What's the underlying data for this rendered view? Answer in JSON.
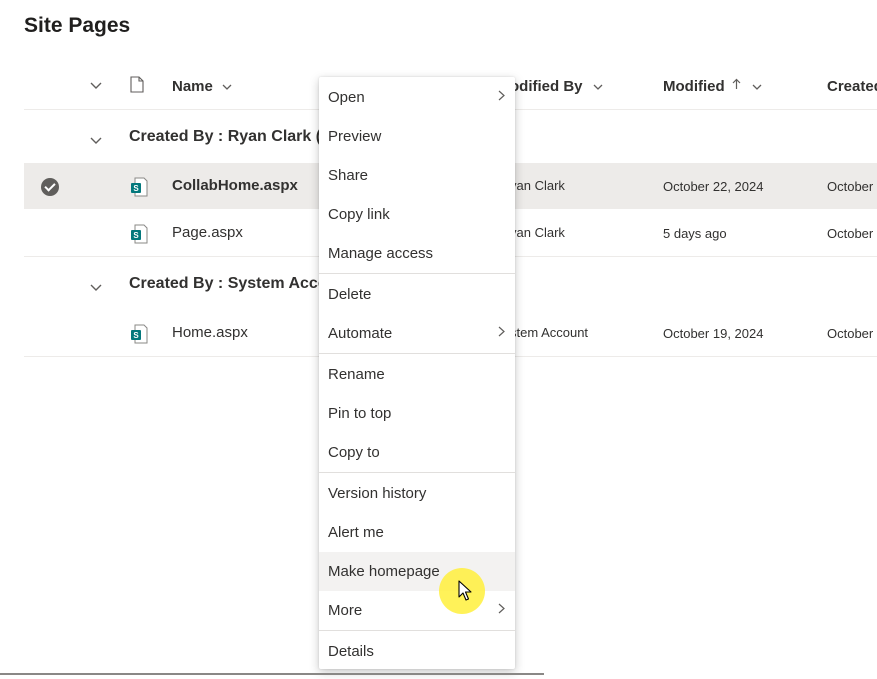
{
  "page": {
    "title": "Site Pages"
  },
  "columns": {
    "name": "Name",
    "modified_by": "odified By",
    "modified": "Modified",
    "modified_sort_icon": "arrow-up-icon",
    "created": "Created"
  },
  "groups": [
    {
      "label": "Created By : Ryan Clark (",
      "rows": [
        {
          "name": "CollabHome.aspx",
          "modified_by": "yan Clark",
          "modified": "October 22, 2024",
          "created": "October",
          "selected": true
        },
        {
          "name": "Page.aspx",
          "modified_by": "yan Clark",
          "modified": "5 days ago",
          "created": "October",
          "selected": false
        }
      ]
    },
    {
      "label": "Created By : System Acco",
      "rows": [
        {
          "name": "Home.aspx",
          "modified_by": "stem Account",
          "modified": "October 19, 2024",
          "created": "October",
          "selected": false
        }
      ]
    }
  ],
  "context_menu": {
    "items": [
      {
        "label": "Open",
        "submenu": true
      },
      {
        "label": "Preview"
      },
      {
        "label": "Share"
      },
      {
        "label": "Copy link"
      },
      {
        "label": "Manage access"
      },
      {
        "label": "Delete"
      },
      {
        "label": "Automate",
        "submenu": true
      },
      {
        "label": "Rename"
      },
      {
        "label": "Pin to top"
      },
      {
        "label": "Copy to"
      },
      {
        "label": "Version history"
      },
      {
        "label": "Alert me"
      },
      {
        "label": "Make homepage",
        "hovered": true
      },
      {
        "label": "More",
        "submenu": true
      },
      {
        "label": "Details"
      }
    ]
  },
  "colors": {
    "sharepoint_icon": "#03787c",
    "selected_row": "#edebe9",
    "menu_hover": "#f3f2f1",
    "cursor_highlight": "#fff03c"
  }
}
